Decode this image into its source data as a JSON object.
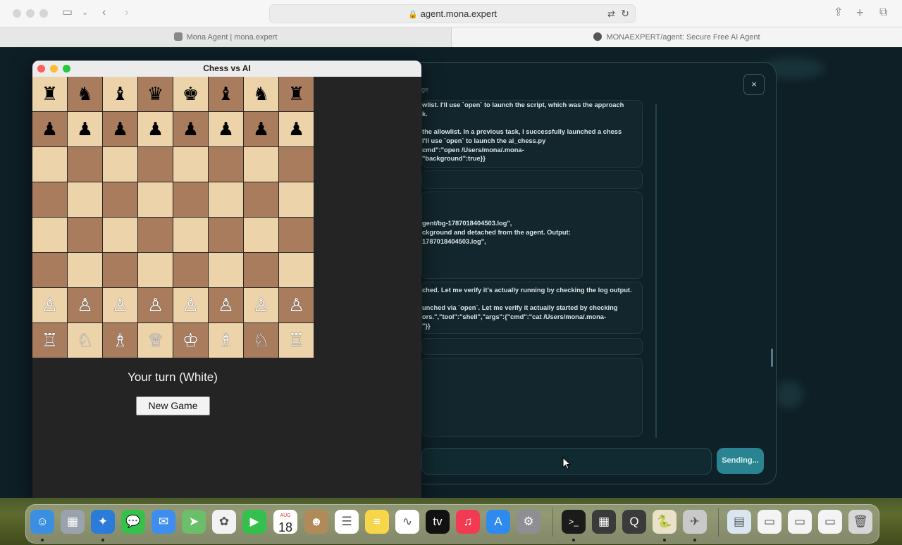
{
  "browser": {
    "url": "agent.mona.expert",
    "tabs": [
      {
        "label": "Mona Agent | mona.expert"
      },
      {
        "label": "MONAEXPERT/agent: Secure Free AI Agent"
      }
    ]
  },
  "background_app": {
    "subtitle_fragment": "ge",
    "close_label": "×",
    "log_entries": [
      {
        "text": "wlist. I'll use `open` to launch the script, which was the approach\nk.\n\nthe allowlist. In a previous task, I successfully launched a chess\nI'll use `open` to launch the ai_chess.py\ncmd\":\"open /Users/mona/.mona-\n\"background\":true}}"
      },
      {
        "text": ""
      },
      {
        "text": "\n\n\ngent/bg-1787018404503.log\",\nckground and detached from the agent. Output:\n1787018404503.log\","
      },
      {
        "text": "ched. Let me verify it's actually running by checking the log output.\n\nunched via `open`. Let me verify it actually started by checking\nors.\",\"tool\":\"shell\",\"args\":{\"cmd\":\"cat /Users/mona/.mona-\n\"}}"
      },
      {
        "text": ""
      },
      {
        "text": ""
      }
    ],
    "send_label": "Sending..."
  },
  "chess": {
    "window_title": "Chess vs AI",
    "board": [
      [
        "♜",
        "♞",
        "♝",
        "♛",
        "♚",
        "♝",
        "♞",
        "♜"
      ],
      [
        "♟",
        "♟",
        "♟",
        "♟",
        "♟",
        "♟",
        "♟",
        "♟"
      ],
      [
        "",
        "",
        "",
        "",
        "",
        "",
        "",
        ""
      ],
      [
        "",
        "",
        "",
        "",
        "",
        "",
        "",
        ""
      ],
      [
        "",
        "",
        "",
        "",
        "",
        "",
        "",
        ""
      ],
      [
        "",
        "",
        "",
        "",
        "",
        "",
        "",
        ""
      ],
      [
        "♙",
        "♙",
        "♙",
        "♙",
        "♙",
        "♙",
        "♙",
        "♙"
      ],
      [
        "♖",
        "♘",
        "♗",
        "♕",
        "♔",
        "♗",
        "♘",
        "♖"
      ]
    ],
    "status": "Your turn (White)",
    "new_game_label": "New Game"
  },
  "dock": {
    "calendar_month": "AUG",
    "calendar_day": "18",
    "apps": [
      {
        "icon": "finder-icon",
        "color": "#3b8fe0",
        "glyph": "☺"
      },
      {
        "icon": "launchpad-icon",
        "color": "#9aa3ad",
        "glyph": "▦"
      },
      {
        "icon": "safari-icon",
        "color": "#2b7bd8",
        "glyph": "✦"
      },
      {
        "icon": "messages-icon",
        "color": "#35c24a",
        "glyph": "💬"
      },
      {
        "icon": "mail-icon",
        "color": "#3e8ef0",
        "glyph": "✉"
      },
      {
        "icon": "maps-icon",
        "color": "#6cbf6a",
        "glyph": "➤"
      },
      {
        "icon": "photos-icon",
        "color": "#f2f2f2",
        "glyph": "✿"
      },
      {
        "icon": "facetime-icon",
        "color": "#33c04c",
        "glyph": "▶"
      },
      {
        "icon": "calendar-icon",
        "color": "#ffffff",
        "glyph": ""
      },
      {
        "icon": "contacts-icon",
        "color": "#b18a5a",
        "glyph": "☻"
      },
      {
        "icon": "reminders-icon",
        "color": "#ffffff",
        "glyph": "☰"
      },
      {
        "icon": "notes-icon",
        "color": "#f7d64a",
        "glyph": "≡"
      },
      {
        "icon": "freeform-icon",
        "color": "#ffffff",
        "glyph": "∿"
      },
      {
        "icon": "tv-icon",
        "color": "#111111",
        "glyph": "tv"
      },
      {
        "icon": "music-icon",
        "color": "#f23b52",
        "glyph": "♫"
      },
      {
        "icon": "appstore-icon",
        "color": "#2f8af0",
        "glyph": "A"
      },
      {
        "icon": "settings-icon",
        "color": "#8e8e93",
        "glyph": "⚙"
      },
      {
        "icon": "terminal-icon",
        "color": "#1b1b1b",
        "glyph": ">_"
      },
      {
        "icon": "calculator-icon",
        "color": "#3a3a3a",
        "glyph": "▦"
      },
      {
        "icon": "quicktime-icon",
        "color": "#3b3b3b",
        "glyph": "Q"
      },
      {
        "icon": "python-icon",
        "color": "#e9e2c8",
        "glyph": "🐍"
      },
      {
        "icon": "rocket-icon",
        "color": "#c9c9c9",
        "glyph": "✈"
      },
      {
        "icon": "archive-icon",
        "color": "#d9e6f2",
        "glyph": "▤"
      },
      {
        "icon": "document-icon",
        "color": "#f4f4f4",
        "glyph": "▭"
      },
      {
        "icon": "document-icon-2",
        "color": "#f4f4f4",
        "glyph": "▭"
      },
      {
        "icon": "document-icon-3",
        "color": "#f4f4f4",
        "glyph": "▭"
      },
      {
        "icon": "trash-icon",
        "color": "#d7d7d7",
        "glyph": "🗑"
      }
    ]
  }
}
